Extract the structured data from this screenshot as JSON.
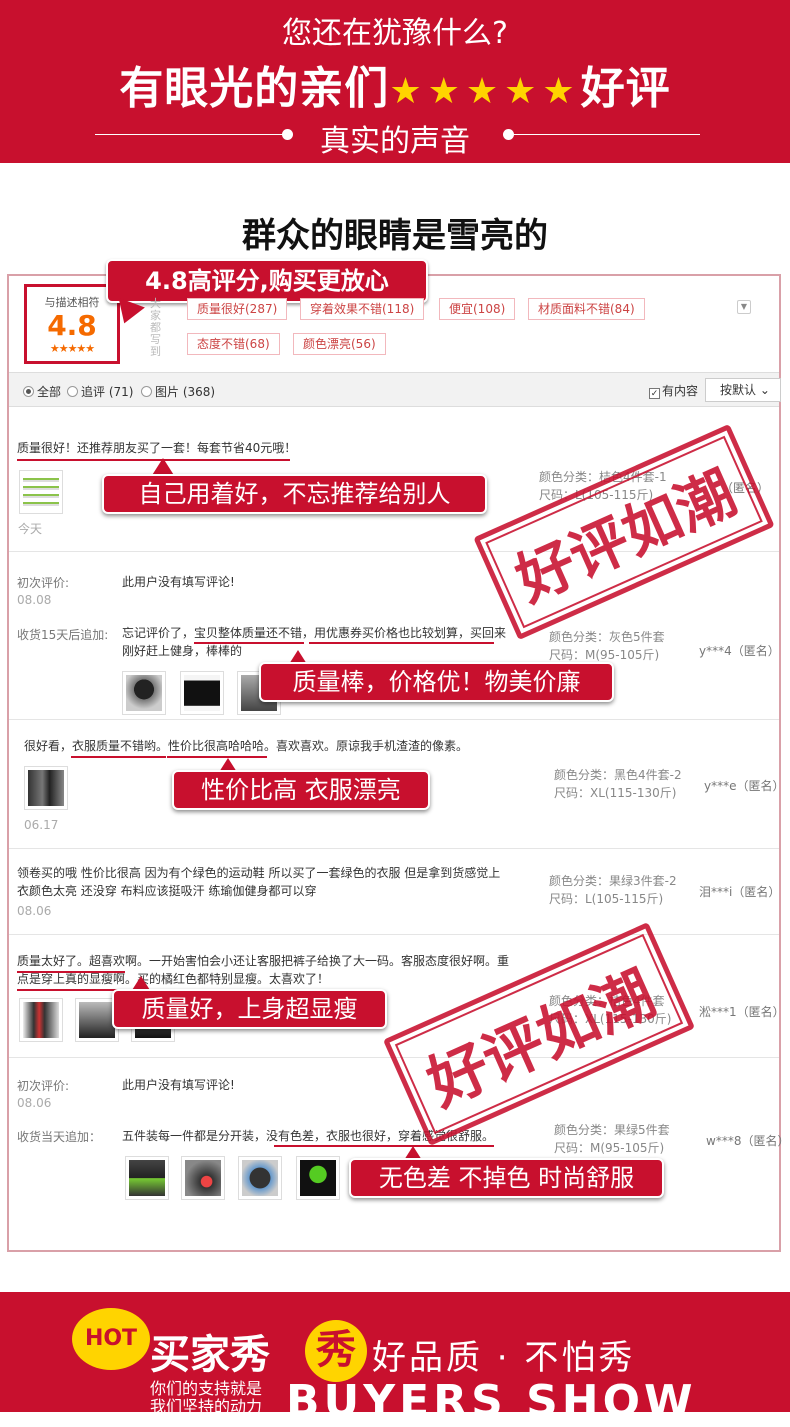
{
  "header": {
    "question": "您还在犹豫什么?",
    "main_left": "有眼光的亲们",
    "main_stars": "★★★★★",
    "main_right": "好评",
    "subtitle": "真实的声音"
  },
  "section_title": "群众的眼睛是雪亮的",
  "rating": {
    "label": "与描述相符",
    "value": "4.8",
    "stars": "★★★★★",
    "callout": "4.8高评分,购买更放心",
    "side_label": "大家都写到"
  },
  "tags": [
    "质量很好(287)",
    "穿着效果不错(118)",
    "便宜(108)",
    "材质面料不错(84)",
    "态度不错(68)",
    "颜色漂亮(56)"
  ],
  "filters": {
    "all": "全部",
    "append": "追评 (71)",
    "pictures": "图片 (368)",
    "has_content": "有内容",
    "sort": "按默认"
  },
  "reviews": [
    {
      "text": "质量很好！还推荐朋友买了一套！每套节省40元哦！",
      "date": "今天",
      "color": "颜色分类：桔色4件套-1",
      "size": "尺码：L(105-115斤)",
      "user": "（匿名）",
      "callout": "自己用着好，不忘推荐给别人"
    },
    {
      "first_label": "初次评价:",
      "first_text": "此用户没有填写评论!",
      "first_date": "08.08",
      "append_label": "收货15天后追加:",
      "append_line1": "忘记评价了，宝贝整体质量还不错，用优惠券买价格也比较划算，买回来",
      "append_line2": "刚好赶上健身，棒棒的",
      "color": "颜色分类：灰色5件套",
      "size": "尺码：M(95-105斤)",
      "user": "y***4（匿名）",
      "callout": "质量棒，价格优！物美价廉"
    },
    {
      "text": "很好看，衣服质量不错哟。性价比很高哈哈哈。喜欢喜欢。原谅我手机渣渣的像素。",
      "date": "06.17",
      "color": "颜色分类：黑色4件套-2",
      "size": "尺码：XL(115-130斤)",
      "user": "y***e（匿名）",
      "callout": "性价比高 衣服漂亮"
    },
    {
      "line1": "领卷买的哦 性价比很高 因为有个绿色的运动鞋 所以买了一套绿色的衣服 但是拿到货感觉上",
      "line2": "衣颜色太亮 还没穿 布料应该挺吸汗 练瑜伽健身都可以穿",
      "date": "08.06",
      "color": "颜色分类：果绿3件套-2",
      "size": "尺码：L(105-115斤)",
      "user": "泪***i（匿名）"
    },
    {
      "line1": "质量太好了。超喜欢啊。一开始害怕会小还让客服把裤子给换了大一码。客服态度很好啊。重",
      "line2": "点是穿上真的显瘦啊。买的橘红色都特别显瘦。太喜欢了！",
      "color": "颜色分类：桔色4件套",
      "size": "尺码：XL(115-130斤)",
      "user": "淞***1（匿名）",
      "callout": "质量好，上身超显瘦"
    },
    {
      "first_label": "初次评价:",
      "first_text": "此用户没有填写评论!",
      "first_date": "08.06",
      "append_label": "收货当天追加：",
      "append_text": "五件装每一件都是分开装，没有色差，衣服也很好，穿着感觉很舒服。",
      "color": "颜色分类：果绿5件套",
      "size": "尺码：M(95-105斤)",
      "user": "w***8（匿名）",
      "callout": "无色差 不掉色 时尚舒服"
    }
  ],
  "stamp_text": "好评如潮",
  "footer": {
    "hot": "HOT",
    "buyer": "买家秀",
    "xiu": "秀",
    "slogan": "好品质 · 不怕秀",
    "small_line1": "你们的支持就是",
    "small_line2": "我们坚持的动力",
    "english": "BUYERS SHOW"
  },
  "colors": {
    "brand_red": "#c8102e",
    "star_yellow": "#ffd400",
    "score_orange": "#f56a00"
  }
}
